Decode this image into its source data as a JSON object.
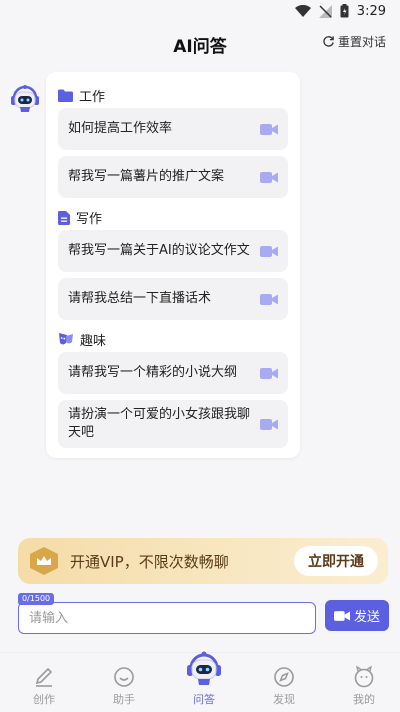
{
  "status_bar": {
    "time": "3:29"
  },
  "header": {
    "title": "AI问答",
    "reset_label": "重置对话"
  },
  "sections": [
    {
      "title": "工作",
      "icon": "folder-icon",
      "items": [
        "如何提高工作效率",
        "帮我写一篇薯片的推广文案"
      ]
    },
    {
      "title": "写作",
      "icon": "document-icon",
      "items": [
        "帮我写一篇关于AI的议论文作文",
        "请帮我总结一下直播话术"
      ]
    },
    {
      "title": "趣味",
      "icon": "mask-icon",
      "items": [
        "请帮我写一个精彩的小说大纲",
        "请扮演一个可爱的小女孩跟我聊天吧"
      ]
    }
  ],
  "vip": {
    "text": "开通VIP，不限次数畅聊",
    "button": "立即开通"
  },
  "input": {
    "counter": "0/1500",
    "placeholder": "请输入",
    "send_label": "发送"
  },
  "tabs": [
    {
      "label": "创作",
      "icon": "pen-icon"
    },
    {
      "label": "助手",
      "icon": "smile-icon"
    },
    {
      "label": "问答",
      "icon": "robot-icon",
      "active": true
    },
    {
      "label": "发现",
      "icon": "compass-icon"
    },
    {
      "label": "我的",
      "icon": "profile-icon"
    }
  ],
  "colors": {
    "accent": "#6a6ee6",
    "vip_bg": "#f5dca7",
    "vip_text": "#5a3b1a"
  }
}
